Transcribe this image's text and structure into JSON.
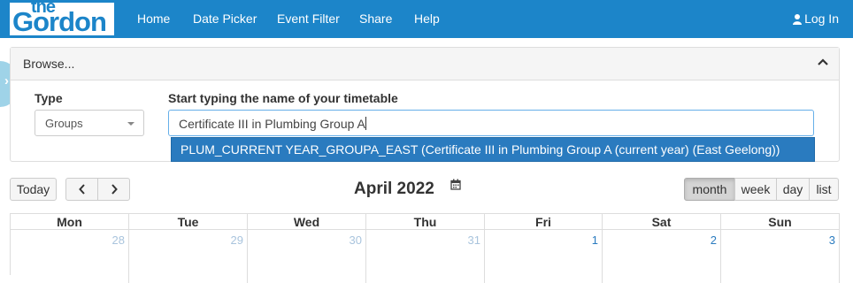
{
  "brand": {
    "logo_small": "the",
    "logo_large": "Gordon"
  },
  "nav": {
    "items": [
      "Home",
      "Date Picker",
      "Event Filter",
      "Share",
      "Help"
    ],
    "login": "Log In"
  },
  "browse": {
    "title": "Browse...",
    "type_label": "Type",
    "type_value": "Groups",
    "search_label": "Start typing the name of your timetable",
    "search_value": "Certificate III in Plumbing Group A",
    "suggestion": "PLUM_CURRENT YEAR_GROUPA_EAST (Certificate III in Plumbing Group A (current year) (East Geelong))"
  },
  "calendar": {
    "today_label": "Today",
    "title": "April 2022",
    "views": [
      "month",
      "week",
      "day",
      "list"
    ],
    "active_view": "month",
    "days": [
      "Mon",
      "Tue",
      "Wed",
      "Thu",
      "Fri",
      "Sat",
      "Sun"
    ],
    "first_row": [
      {
        "day": "28",
        "other_month": true
      },
      {
        "day": "29",
        "other_month": true
      },
      {
        "day": "30",
        "other_month": true
      },
      {
        "day": "31",
        "other_month": true
      },
      {
        "day": "1",
        "other_month": false
      },
      {
        "day": "2",
        "other_month": false
      },
      {
        "day": "3",
        "other_month": false
      }
    ]
  },
  "colors": {
    "navbar": "#1c85c9",
    "selected": "#2a7bbf",
    "other_month_text": "#a9c4dd"
  }
}
